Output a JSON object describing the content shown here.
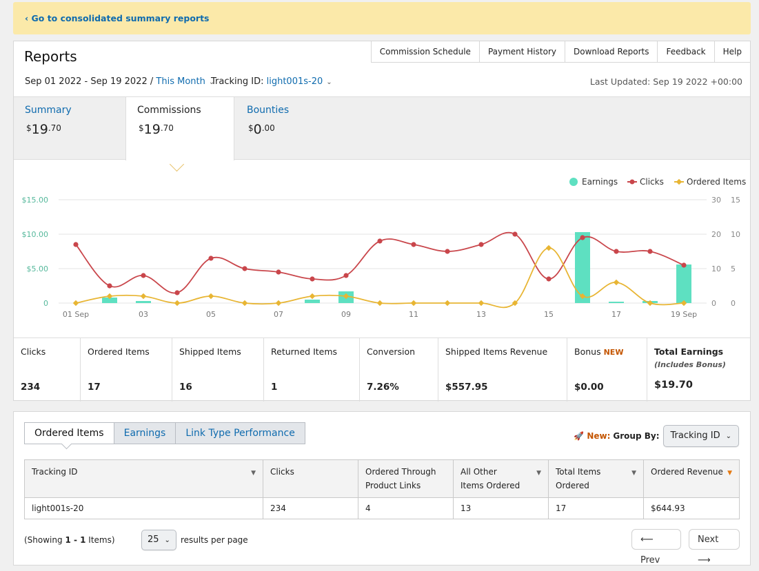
{
  "banner": {
    "text": "‹ Go to consolidated summary reports"
  },
  "header": {
    "title": "Reports",
    "nav": [
      "Commission Schedule",
      "Payment History",
      "Download Reports",
      "Feedback",
      "Help"
    ],
    "date_range": "Sep 01 2022 - Sep 19 2022 /",
    "period": "This Month",
    "tracking_label": "Tracking ID:",
    "tracking_id": "light001s-20",
    "last_updated": "Last Updated: Sep 19 2022 +00:00"
  },
  "tabs": [
    {
      "label": "Summary",
      "dollar": "$",
      "whole": "19",
      "cents": ".70"
    },
    {
      "label": "Commissions",
      "dollar": "$",
      "whole": "19",
      "cents": ".70"
    },
    {
      "label": "Bounties",
      "dollar": "$",
      "whole": "0",
      "cents": ".00"
    }
  ],
  "chart_data": {
    "type": "bar+line",
    "legend": [
      "Earnings",
      "Clicks",
      "Ordered Items"
    ],
    "legend_position": "top-right",
    "colors": {
      "earnings": "#5ee0c1",
      "clicks": "#c9464b",
      "ordered": "#e8b533",
      "left_axis": "#55b89b",
      "right_axis": "#888888"
    },
    "x_tick_labels": [
      "01 Sep",
      "03",
      "05",
      "07",
      "09",
      "11",
      "13",
      "15",
      "17",
      "19 Sep"
    ],
    "left_axis": {
      "ticks": [
        "$15.00",
        "$10.00",
        "$5.00",
        "0"
      ],
      "ylim": [
        0,
        15
      ]
    },
    "right_axis_clicks": {
      "ticks": [
        "30",
        "20",
        "10",
        "0"
      ],
      "ylim": [
        0,
        30
      ]
    },
    "right_axis_ordered": {
      "ticks": [
        "15",
        "10",
        "5",
        "0"
      ],
      "ylim": [
        0,
        15
      ]
    },
    "days": [
      1,
      2,
      3,
      4,
      5,
      6,
      7,
      8,
      9,
      10,
      11,
      12,
      13,
      14,
      15,
      16,
      17,
      18,
      19
    ],
    "series": [
      {
        "name": "Earnings",
        "values": [
          0,
          0.8,
          0.3,
          0,
          0,
          0,
          0,
          0.5,
          1.7,
          0,
          0,
          0,
          0,
          0,
          0,
          10.3,
          0.2,
          0.3,
          5.6
        ]
      },
      {
        "name": "Clicks",
        "values": [
          17,
          5,
          8,
          3,
          13,
          10,
          9,
          7,
          8,
          18,
          17,
          15,
          17,
          20,
          7,
          19,
          15,
          15,
          11
        ]
      },
      {
        "name": "Ordered Items",
        "values": [
          0,
          1,
          1,
          0,
          1,
          0,
          0,
          1,
          1,
          0,
          0,
          0,
          0,
          0,
          8,
          1,
          3,
          0,
          0
        ]
      }
    ]
  },
  "stats": [
    {
      "label": "Clicks",
      "value": "234"
    },
    {
      "label": "Ordered Items",
      "value": "17"
    },
    {
      "label": "Shipped Items",
      "value": "16"
    },
    {
      "label": "Returned Items",
      "value": "1"
    },
    {
      "label": "Conversion",
      "value": "7.26%"
    },
    {
      "label": "Shipped Items Revenue",
      "value": "$557.95"
    },
    {
      "label": "Bonus",
      "badge": "NEW",
      "value": "$0.00"
    },
    {
      "label": "Total Earnings",
      "sub": "(Includes Bonus)",
      "value": "$19.70"
    }
  ],
  "bottom": {
    "tabs": [
      "Ordered Items",
      "Earnings",
      "Link Type Performance"
    ],
    "new_label": "New:",
    "group_by_label": "Group By:",
    "group_by_value": "Tracking ID",
    "columns": [
      "Tracking ID",
      "Clicks",
      "Ordered Through Product Links",
      "All Other Items Ordered",
      "Total Items Ordered",
      "Ordered Revenue"
    ],
    "rows": [
      [
        "light001s-20",
        "234",
        "4",
        "13",
        "17",
        "$644.93"
      ]
    ],
    "showing_prefix": "(Showing ",
    "showing_range": "1 - 1",
    "showing_suffix": " Items)",
    "per_page": "25",
    "per_page_label": "results per page",
    "prev": "Prev",
    "next": "Next"
  }
}
